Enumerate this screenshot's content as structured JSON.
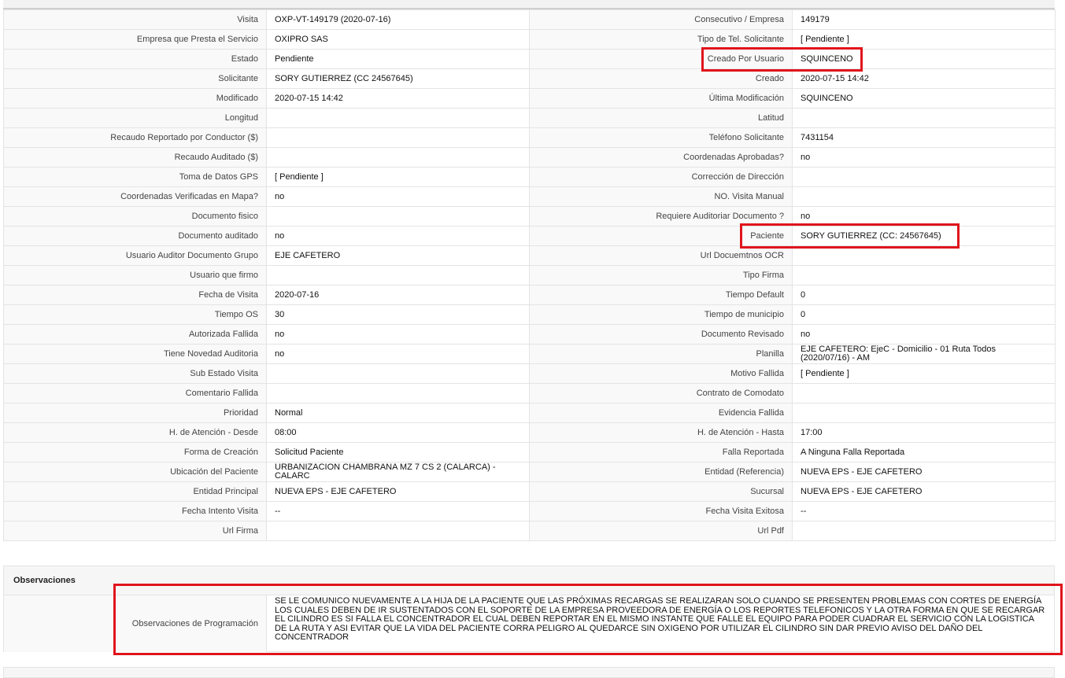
{
  "visit": {
    "rows": [
      {
        "l1": "Visita",
        "v1": "OXP-VT-149179 (2020-07-16)",
        "l2": "Consecutivo / Empresa",
        "v2": "149179"
      },
      {
        "l1": "Empresa que Presta el Servicio",
        "v1": "OXIPRO SAS",
        "l2": "Tipo de Tel. Solicitante",
        "v2": "[ Pendiente ]"
      },
      {
        "l1": "Estado",
        "v1": "Pendiente",
        "l2": "Creado Por Usuario",
        "v2": "SQUINCENO"
      },
      {
        "l1": "Solicitante",
        "v1": "SORY GUTIERREZ (CC 24567645)",
        "l2": "Creado",
        "v2": "2020-07-15 14:42"
      },
      {
        "l1": "Modificado",
        "v1": "2020-07-15 14:42",
        "l2": "Última Modificación",
        "v2": " SQUINCENO"
      },
      {
        "l1": "Longitud",
        "v1": "",
        "l2": "Latitud",
        "v2": ""
      },
      {
        "l1": "Recaudo Reportado por Conductor ($)",
        "v1": "",
        "l2": "Teléfono Solicitante",
        "v2": "7431154"
      },
      {
        "l1": "Recaudo Auditado ($)",
        "v1": "",
        "l2": "Coordenadas Aprobadas?",
        "v2": " no"
      },
      {
        "l1": "Toma de Datos GPS",
        "v1": "[ Pendiente ]",
        "l2": "Corrección de Dirección",
        "v2": ""
      },
      {
        "l1": "Coordenadas Verificadas en Mapa?",
        "v1": " no",
        "l2": "NO. Visita Manual",
        "v2": ""
      },
      {
        "l1": "Documento fisico",
        "v1": "",
        "l2": "Requiere Auditoriar Documento ?",
        "v2": " no"
      },
      {
        "l1": "Documento auditado",
        "v1": " no",
        "l2": "Paciente",
        "v2": "SORY GUTIERREZ (CC: 24567645)"
      },
      {
        "l1": "Usuario Auditor Documento Grupo",
        "v1": "EJE CAFETERO",
        "l2": "Url Docuemtnos OCR",
        "v2": ""
      },
      {
        "l1": "Usuario que firmo",
        "v1": "",
        "l2": "Tipo Firma",
        "v2": ""
      },
      {
        "l1": "Fecha de Visita",
        "v1": " 2020-07-16",
        "l2": "Tiempo Default",
        "v2": "0"
      },
      {
        "l1": "Tiempo OS",
        "v1": "30",
        "l2": "Tiempo de municipio",
        "v2": "0"
      },
      {
        "l1": "Autorizada Fallida",
        "v1": " no",
        "l2": "Documento Revisado",
        "v2": " no"
      },
      {
        "l1": "Tiene Novedad Auditoria",
        "v1": " no",
        "l2": "Planilla",
        "v2": "EJE CAFETERO: EjeC - Domicilio - 01 Ruta Todos (2020/07/16) - AM"
      },
      {
        "l1": "Sub Estado Visita",
        "v1": "",
        "l2": "Motivo Fallida",
        "v2": "[ Pendiente ]"
      },
      {
        "l1": "Comentario Fallida",
        "v1": "",
        "l2": "Contrato de Comodato",
        "v2": ""
      },
      {
        "l1": "Prioridad",
        "v1": "Normal",
        "l2": "Evidencia Fallida",
        "v2": ""
      },
      {
        "l1": "H. de Atención - Desde",
        "v1": "08:00",
        "l2": "H. de Atención - Hasta",
        "v2": "17:00"
      },
      {
        "l1": "Forma de Creación",
        "v1": "Solicitud Paciente",
        "l2": "Falla Reportada",
        "v2": "A Ninguna Falla Reportada"
      },
      {
        "l1": "Ubicación del Paciente",
        "v1": "URBANIZACION CHAMBRANA MZ 7 CS 2 (CALARCA) - CALARC",
        "l2": "Entidad (Referencia)",
        "v2": "NUEVA EPS - EJE CAFETERO"
      },
      {
        "l1": "Entidad Principal",
        "v1": "NUEVA EPS - EJE CAFETERO",
        "l2": "Sucursal",
        "v2": "NUEVA EPS - EJE CAFETERO"
      },
      {
        "l1": "Fecha Intento Visita",
        "v1": " --",
        "l2": "Fecha Visita Exitosa",
        "v2": " --"
      },
      {
        "l1": "Url Firma",
        "v1": "",
        "l2": "Url Pdf",
        "v2": ""
      }
    ]
  },
  "observaciones": {
    "title": "Observaciones",
    "label": "Observaciones de Programación",
    "text": "  SE LE COMUNICO NUEVAMENTE A LA HIJA DE LA PACIENTE QUE LAS PRÓXIMAS RECARGAS SE REALIZARAN SOLO CUANDO SE PRESENTEN PROBLEMAS CON CORTES DE ENERGÍA LOS CUALES DEBEN DE IR SUSTENTADOS CON EL SOPORTE DE LA EMPRESA PROVEEDORA DE ENERGÍA O LOS REPORTES TELEFONICOS Y LA OTRA FORMA EN QUE SE RECARGAR EL CILINDRO ES SI FALLA EL CONCENTRADOR EL CUAL DEBEN REPORTAR EN EL MISMO INSTANTE QUE FALLE EL EQUIPO PARA PODER CUADRAR EL SERVICIO CON LA LOGISTICA DE LA RUTA Y ASI EVITAR QUE LA VIDA DEL PACIENTE CORRA PELIGRO AL QUEDARCE SIN OXIGENO POR UTILIZAR EL CILINDRO SIN DAR PREVIO AVISO DEL DAÑO DEL CONCENTRADOR"
  },
  "colors": {
    "highlight": "#e0141c",
    "label_bg": "#f9f9f9",
    "border": "#e4e4e4"
  }
}
